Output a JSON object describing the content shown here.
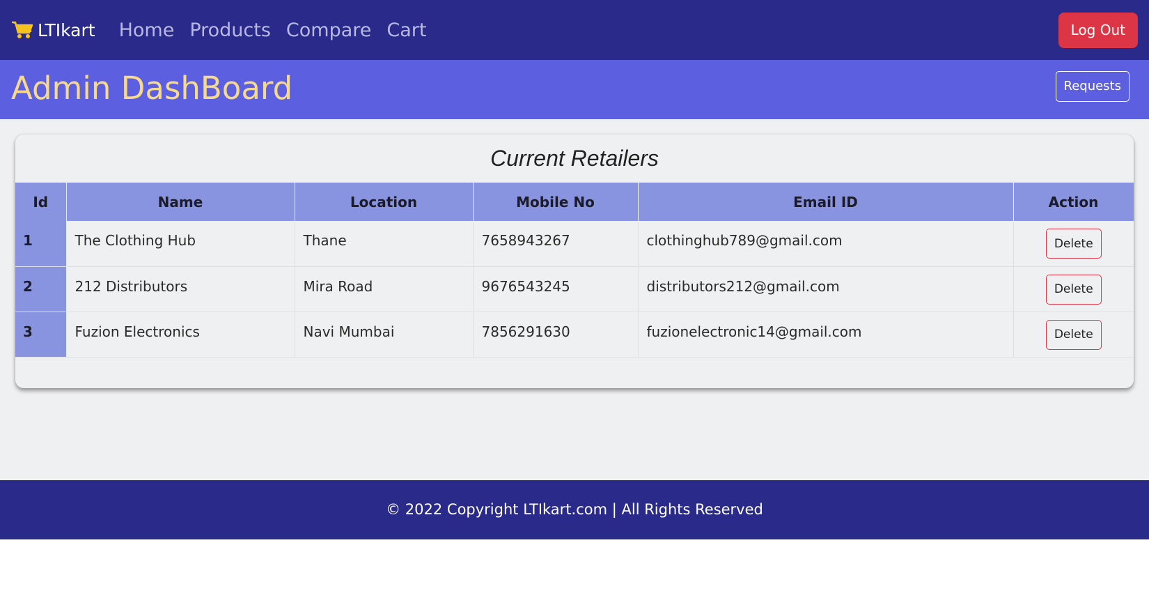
{
  "navbar": {
    "brand": "LTIkart",
    "links": [
      "Home",
      "Products",
      "Compare",
      "Cart"
    ],
    "logout_label": "Log Out"
  },
  "header": {
    "title": "Admin DashBoard",
    "requests_label": "Requests"
  },
  "retailers": {
    "title": "Current Retailers",
    "columns": [
      "Id",
      "Name",
      "Location",
      "Mobile No",
      "Email ID",
      "Action"
    ],
    "rows": [
      {
        "id": "1",
        "name": "The Clothing Hub",
        "location": "Thane",
        "mobile": "7658943267",
        "email": "clothinghub789@gmail.com",
        "action": "Delete"
      },
      {
        "id": "2",
        "name": "212 Distributors",
        "location": "Mira Road",
        "mobile": "9676543245",
        "email": "distributors212@gmail.com",
        "action": "Delete"
      },
      {
        "id": "3",
        "name": "Fuzion Electronics",
        "location": "Navi Mumbai",
        "mobile": "7856291630",
        "email": "fuzionelectronic14@gmail.com",
        "action": "Delete"
      }
    ]
  },
  "footer": {
    "text": "© 2022 Copyright LTIkart.com | All Rights Reserved"
  },
  "colors": {
    "navbar_bg": "#2a2a8a",
    "header_bg": "#5c60e0",
    "title_color": "#f6d98a",
    "logout_bg": "#dc3545",
    "table_header_bg": "#8894e0"
  },
  "icons": {
    "brand_icon": "shopping-cart-icon"
  }
}
